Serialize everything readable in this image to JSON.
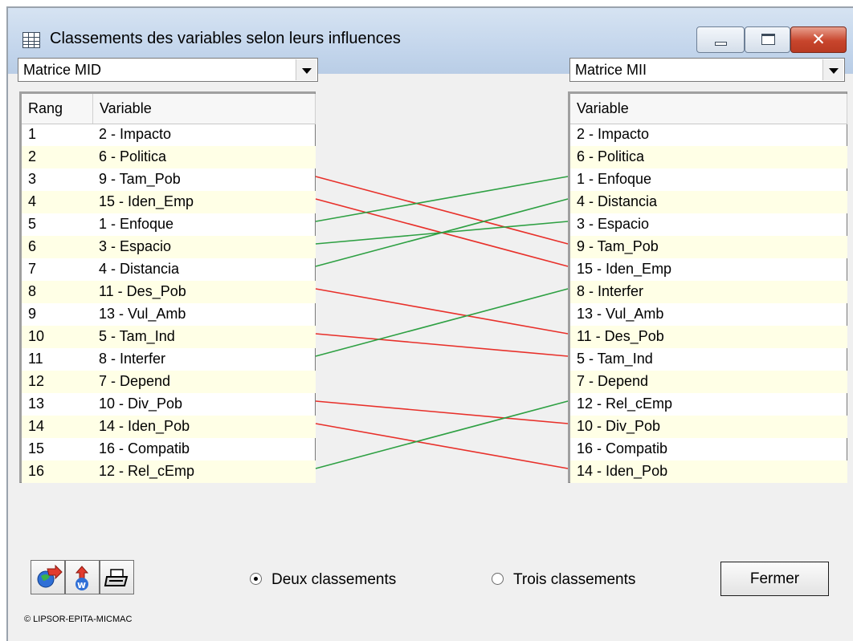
{
  "window": {
    "title": "Classements des variables selon leurs influences",
    "close_glyph": "✕"
  },
  "left_combo": {
    "value": "Matrice MID"
  },
  "right_combo": {
    "value": "Matrice MII"
  },
  "left_list": {
    "headers": [
      "Rang",
      "Variable"
    ],
    "rows": [
      [
        "1",
        "2 - Impacto"
      ],
      [
        "2",
        "6 - Politica"
      ],
      [
        "3",
        "9 - Tam_Pob"
      ],
      [
        "4",
        "15 - Iden_Emp"
      ],
      [
        "5",
        "1 - Enfoque"
      ],
      [
        "6",
        "3 - Espacio"
      ],
      [
        "7",
        "4 - Distancia"
      ],
      [
        "8",
        "11 - Des_Pob"
      ],
      [
        "9",
        "13 - Vul_Amb"
      ],
      [
        "10",
        "5 - Tam_Ind"
      ],
      [
        "11",
        "8 - Interfer"
      ],
      [
        "12",
        "7 - Depend"
      ],
      [
        "13",
        "10 - Div_Pob"
      ],
      [
        "14",
        "14 - Iden_Pob"
      ],
      [
        "15",
        "16 - Compatib"
      ],
      [
        "16",
        "12 - Rel_cEmp"
      ]
    ]
  },
  "right_list": {
    "header": "Variable",
    "rows": [
      "2 - Impacto",
      "6 - Politica",
      "1 - Enfoque",
      "4 - Distancia",
      "3 - Espacio",
      "9 - Tam_Pob",
      "15 - Iden_Emp",
      "8 - Interfer",
      "13 - Vul_Amb",
      "11 - Des_Pob",
      "5 - Tam_Ind",
      "7 - Depend",
      "12 - Rel_cEmp",
      "10 - Div_Pob",
      "16 - Compatib",
      "14 - Iden_Pob"
    ]
  },
  "connections": [
    {
      "from": 3,
      "to": 6,
      "color": "#e8302a"
    },
    {
      "from": 4,
      "to": 7,
      "color": "#e8302a"
    },
    {
      "from": 5,
      "to": 3,
      "color": "#2ea043"
    },
    {
      "from": 6,
      "to": 5,
      "color": "#2ea043"
    },
    {
      "from": 7,
      "to": 4,
      "color": "#2ea043"
    },
    {
      "from": 8,
      "to": 10,
      "color": "#e8302a"
    },
    {
      "from": 10,
      "to": 11,
      "color": "#e8302a"
    },
    {
      "from": 11,
      "to": 8,
      "color": "#2ea043"
    },
    {
      "from": 13,
      "to": 14,
      "color": "#e8302a"
    },
    {
      "from": 14,
      "to": 16,
      "color": "#e8302a"
    },
    {
      "from": 16,
      "to": 13,
      "color": "#2ea043"
    }
  ],
  "toolbar": {
    "icons": [
      "export-globe-icon",
      "word-export-icon",
      "print-icon"
    ]
  },
  "options": {
    "two_label": "Deux classements",
    "three_label": "Trois classements",
    "selected": "two"
  },
  "close_button": {
    "label": "Fermer"
  },
  "footer": {
    "copyright": "© LIPSOR-EPITA-MICMAC"
  }
}
